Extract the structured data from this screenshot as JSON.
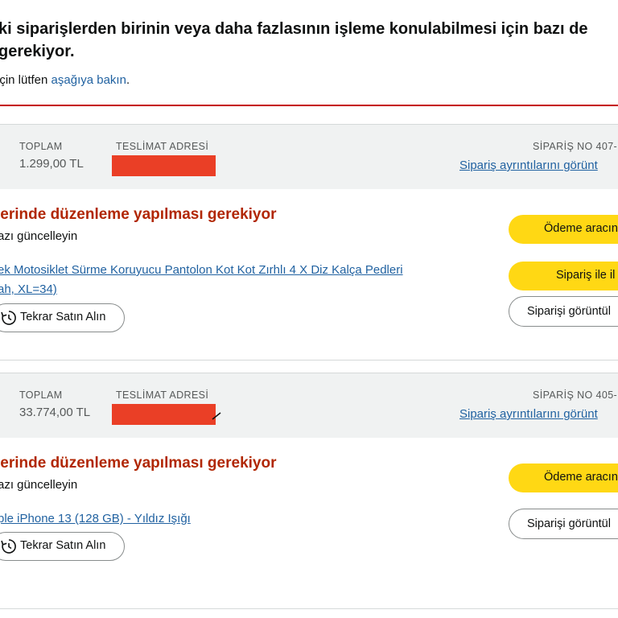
{
  "alert": {
    "heading_line1": "ki siparişlerden birinin veya daha fazlasının işleme konulabilmesi için bazı de",
    "heading_line2": "gerekiyor.",
    "sub_prefix": "için lütfen ",
    "sub_link": "aşağıya bakın",
    "sub_suffix": "."
  },
  "orders": [
    {
      "total_caption": "TOPLAM",
      "total_value": "1.299,00 TL",
      "address_caption": "TESLİMAT ADRESİ",
      "order_no_caption": "SİPARİŞ NO 407-",
      "details_link": "Sipariş ayrıntılarını görünt",
      "status_title": "lerinde düzenleme yapılması gerekiyor",
      "status_sub": "azı güncelleyin",
      "product_line1": "ek Motosiklet Sürme Koruyucu Pantolon Kot Kot Zırhlı 4 X Diz Kalça Pedleri",
      "product_line2": "ah, XL=34)",
      "rebuy_label": "Tekrar Satın Alın",
      "btn_payment": "Ödeme aracın",
      "btn_contact": "Sipariş ile il",
      "btn_view": "Siparişi görüntül"
    },
    {
      "total_caption": "TOPLAM",
      "total_value": "33.774,00 TL",
      "address_caption": "TESLİMAT ADRESİ",
      "order_no_caption": "SİPARİŞ NO 405-",
      "details_link": "Sipariş ayrıntılarını görünt",
      "status_title": "lerinde düzenleme yapılması gerekiyor",
      "status_sub": "azı güncelleyin",
      "product_line1": "ple iPhone 13 (128 GB) - Yıldız Işığı",
      "rebuy_label": "Tekrar Satın Alın",
      "btn_payment": "Ödeme aracın",
      "btn_view": "Siparişi görüntül"
    }
  ],
  "colors": {
    "alert_border": "#c40000",
    "status_red": "#b12704",
    "link_blue": "#2162a1",
    "button_yellow": "#ffd814",
    "redaction": "#ea3f26"
  }
}
